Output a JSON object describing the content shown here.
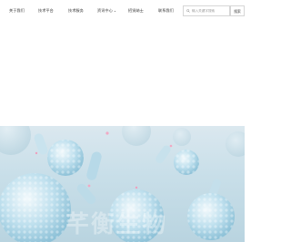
{
  "nav": {
    "items": [
      {
        "label": "关于我们"
      },
      {
        "label": "技术平台"
      },
      {
        "label": "技术服务"
      },
      {
        "label": "资讯中心",
        "has_dropdown": true
      },
      {
        "label": "招贤纳士"
      },
      {
        "label": "联系我们"
      }
    ]
  },
  "search": {
    "placeholder": "输入关键字搜索",
    "button_label": "搜索",
    "icon": "search-icon"
  },
  "banner": {
    "watermark_text": "芊衡生物",
    "theme_color": "#bcd6e2"
  }
}
